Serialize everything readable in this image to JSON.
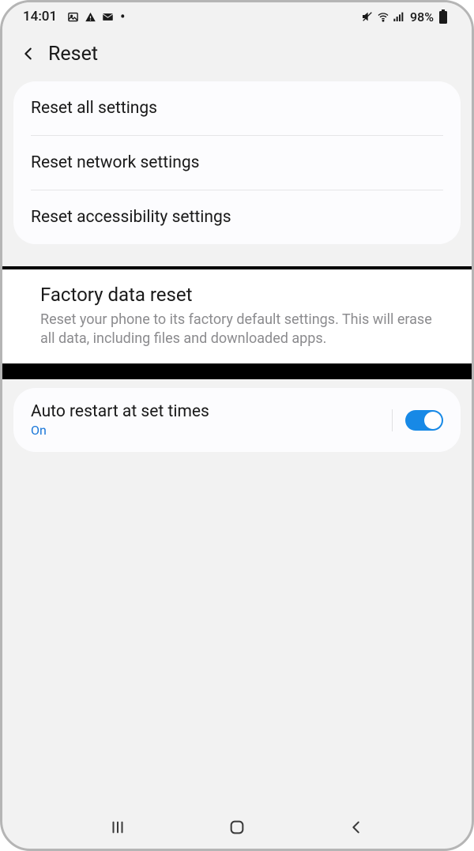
{
  "statusBar": {
    "time": "14:01",
    "batteryPercent": "98%"
  },
  "header": {
    "title": "Reset"
  },
  "resetOptions": {
    "items": [
      {
        "label": "Reset all settings"
      },
      {
        "label": "Reset network settings"
      },
      {
        "label": "Reset accessibility settings"
      }
    ]
  },
  "factoryReset": {
    "title": "Factory data reset",
    "description": "Reset your phone to its factory default settings. This will erase all data, including files and downloaded apps."
  },
  "autoRestart": {
    "title": "Auto restart at set times",
    "status": "On",
    "enabled": true
  }
}
